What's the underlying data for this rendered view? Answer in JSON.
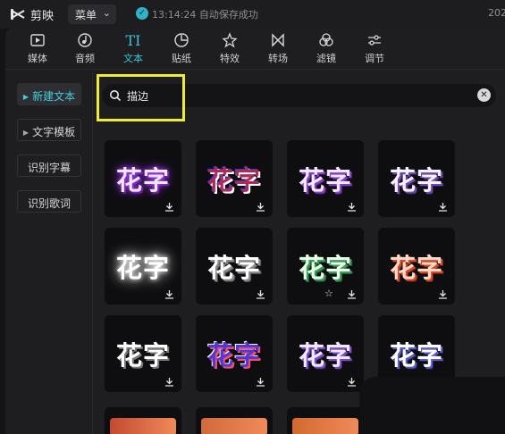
{
  "titlebar": {
    "app_name": "剪映",
    "menu_label": "菜单",
    "save_status": "13:14:24 自动保存成功",
    "year_partial": "202"
  },
  "toolbar": {
    "tabs": [
      {
        "label": "媒体",
        "icon": "media-icon"
      },
      {
        "label": "音频",
        "icon": "audio-icon"
      },
      {
        "label": "文本",
        "icon": "text-icon",
        "active": true
      },
      {
        "label": "贴纸",
        "icon": "sticker-icon"
      },
      {
        "label": "特效",
        "icon": "effects-icon"
      },
      {
        "label": "转场",
        "icon": "transition-icon"
      },
      {
        "label": "滤镜",
        "icon": "filter-icon"
      },
      {
        "label": "调节",
        "icon": "adjust-icon"
      }
    ]
  },
  "sidebar": {
    "items": [
      {
        "label": "新建文本",
        "active": true,
        "arrow": true
      },
      {
        "label": "文字模板",
        "arrow": true
      },
      {
        "label": "识别字幕"
      },
      {
        "label": "识别歌词"
      }
    ]
  },
  "search": {
    "value": "描边"
  },
  "grid": {
    "tile_text": "花字",
    "tiles": [
      {
        "style": "purple-glow"
      },
      {
        "style": "red-white-outline"
      },
      {
        "style": "purple-stroke"
      },
      {
        "style": "lavender-stroke"
      },
      {
        "style": "white-glow"
      },
      {
        "style": "white-gray-stroke"
      },
      {
        "style": "green-stroke",
        "favorite": true
      },
      {
        "style": "orange-stroke"
      },
      {
        "style": "white-plain"
      },
      {
        "style": "blue-red-outline"
      },
      {
        "style": "purple-shadow"
      },
      {
        "style": "blue-shadow"
      }
    ]
  },
  "colors": {
    "accent": "#35c6d6",
    "highlight_box": "#f2ec2e",
    "background": "#1e1e21"
  }
}
